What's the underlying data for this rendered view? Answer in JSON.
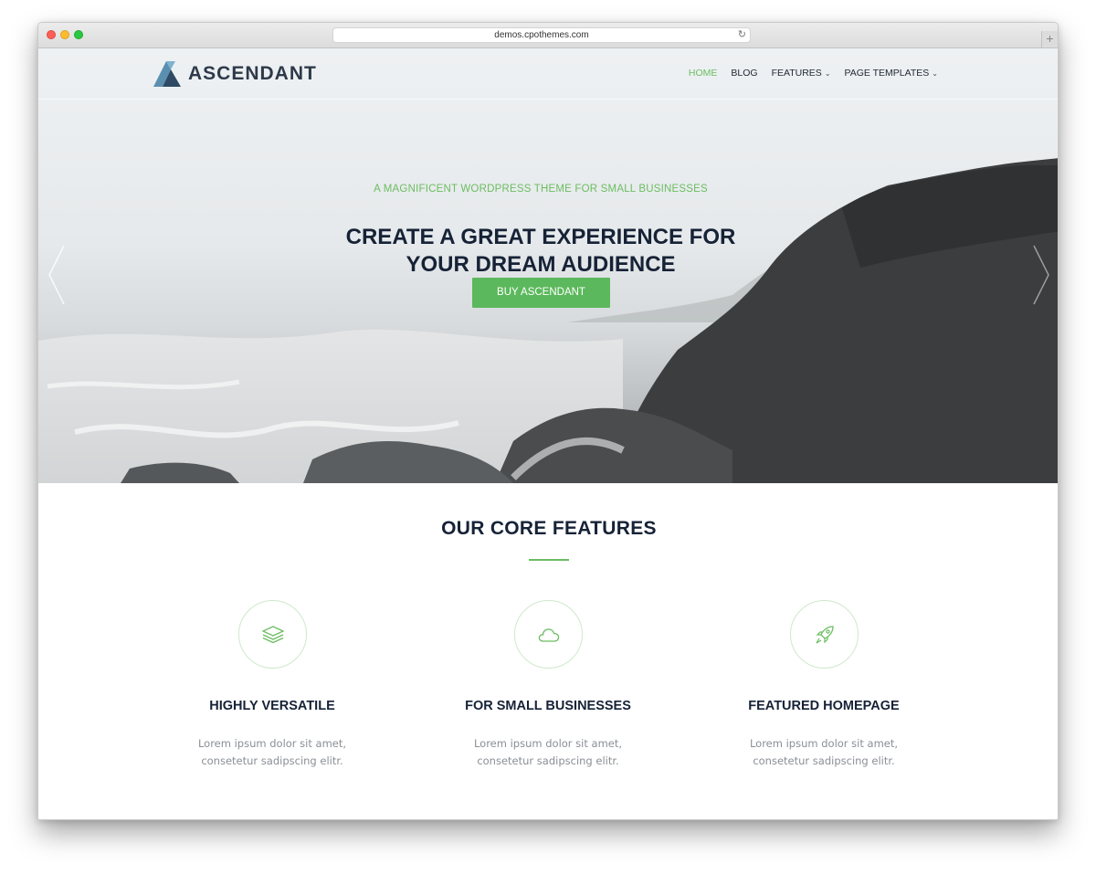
{
  "browser": {
    "url": "demos.cpothemes.com",
    "reload_icon": "reload-icon",
    "new_tab_label": "+"
  },
  "site": {
    "logo_text": "ASCENDANT",
    "nav": [
      {
        "label": "HOME",
        "active": true
      },
      {
        "label": "BLOG"
      },
      {
        "label": "FEATURES",
        "dropdown": true
      },
      {
        "label": "PAGE TEMPLATES",
        "dropdown": true
      }
    ]
  },
  "hero": {
    "tagline": "A MAGNIFICENT WORDPRESS THEME FOR SMALL BUSINESSES",
    "headline_line1": "CREATE A GREAT EXPERIENCE FOR",
    "headline_line2": "YOUR DREAM AUDIENCE",
    "cta_label": "BUY ASCENDANT"
  },
  "features": {
    "title": "OUR CORE FEATURES",
    "items": [
      {
        "icon": "layers-icon",
        "title": "HIGHLY VERSATILE",
        "text": "Lorem ipsum dolor sit amet, consetetur sadipscing elitr."
      },
      {
        "icon": "cloud-icon",
        "title": "FOR SMALL BUSINESSES",
        "text": "Lorem ipsum dolor sit amet, consetetur sadipscing elitr."
      },
      {
        "icon": "rocket-icon",
        "title": "FEATURED HOMEPAGE",
        "text": "Lorem ipsum dolor sit amet, consetetur sadipscing elitr."
      }
    ]
  },
  "colors": {
    "accent": "#6cbd62",
    "button": "#5cb85c",
    "heading": "#162236"
  }
}
